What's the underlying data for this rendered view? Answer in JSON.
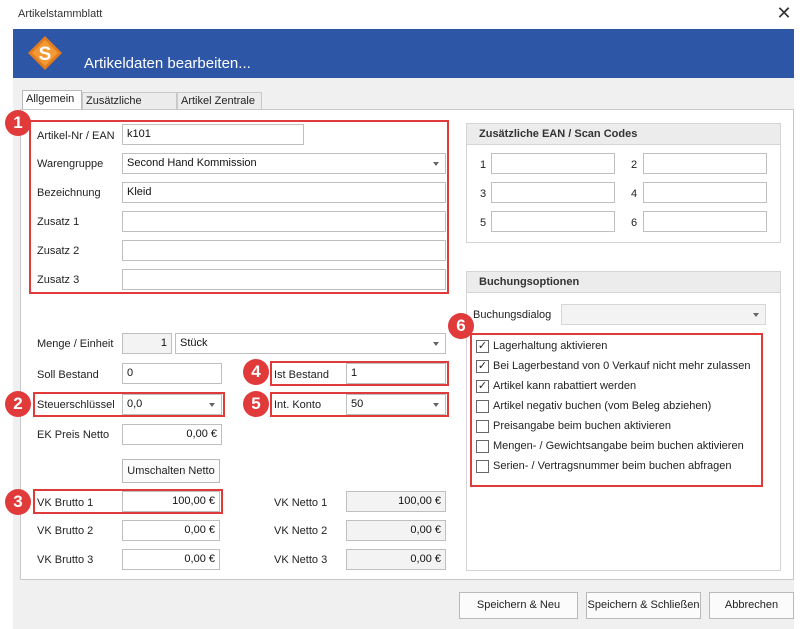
{
  "window": {
    "title": "Artikelstammblatt",
    "close_glyph": "✕"
  },
  "banner": {
    "heading": "Artikeldaten bearbeiten...",
    "bg": "#2d56a6"
  },
  "tabs": [
    "Allgemein",
    "Zusätzliche Daten",
    "Artikel Zentrale"
  ],
  "fields": {
    "artikelnr": {
      "label": "Artikel-Nr / EAN",
      "value": "k101"
    },
    "warengruppe": {
      "label": "Warengruppe",
      "value": "Second Hand Kommission"
    },
    "bezeichnung": {
      "label": "Bezeichnung",
      "value": "Kleid"
    },
    "zusatz1": {
      "label": "Zusatz 1",
      "value": ""
    },
    "zusatz2": {
      "label": "Zusatz 2",
      "value": ""
    },
    "zusatz3": {
      "label": "Zusatz 3",
      "value": ""
    },
    "menge": {
      "label": "Menge / Einheit",
      "qty": "1",
      "unit": "Stück"
    },
    "soll_bestand": {
      "label": "Soll Bestand",
      "value": "0"
    },
    "ist_bestand": {
      "label": "Ist Bestand",
      "value": "1"
    },
    "steuerschluessel": {
      "label": "Steuerschlüssel",
      "value": "0,0"
    },
    "int_konto": {
      "label": "Int. Konto",
      "value": "50"
    },
    "ek_preis": {
      "label": "EK Preis Netto",
      "value": "0,00 €"
    },
    "umschalten_label": "Umschalten Netto",
    "vk_brutto1": {
      "label": "VK Brutto 1",
      "value": "100,00 €"
    },
    "vk_brutto2": {
      "label": "VK Brutto 2",
      "value": "0,00 €"
    },
    "vk_brutto3": {
      "label": "VK Brutto 3",
      "value": "0,00 €"
    },
    "vk_netto1": {
      "label": "VK Netto 1",
      "value": "100,00 €"
    },
    "vk_netto2": {
      "label": "VK Netto 2",
      "value": "0,00 €"
    },
    "vk_netto3": {
      "label": "VK Netto 3",
      "value": "0,00 €"
    }
  },
  "ean_group": {
    "title": "Zusätzliche EAN / Scan Codes",
    "labels": [
      "1",
      "2",
      "3",
      "4",
      "5",
      "6"
    ]
  },
  "booking": {
    "title": "Buchungsoptionen",
    "dialog_label": "Buchungsdialog",
    "options": [
      {
        "label": "Lagerhaltung aktivieren",
        "checked": true
      },
      {
        "label": "Bei Lagerbestand von 0 Verkauf nicht mehr zulassen",
        "checked": true
      },
      {
        "label": "Artikel kann rabattiert werden",
        "checked": true
      },
      {
        "label": "Artikel negativ buchen (vom Beleg abziehen)",
        "checked": false
      },
      {
        "label": "Preisangabe beim buchen aktivieren",
        "checked": false
      },
      {
        "label": "Mengen- / Gewichtsangabe beim buchen aktivieren",
        "checked": false
      },
      {
        "label": "Serien- / Vertragsnummer beim buchen abfragen",
        "checked": false
      }
    ]
  },
  "markers": [
    "1",
    "2",
    "3",
    "4",
    "5",
    "6"
  ],
  "buttons": {
    "save_new": "Speichern & Neu",
    "save_close": "Speichern & Schließen",
    "cancel": "Abbrechen"
  },
  "colors": {
    "highlight": "#e03a3a",
    "banner": "#2d56a6"
  }
}
